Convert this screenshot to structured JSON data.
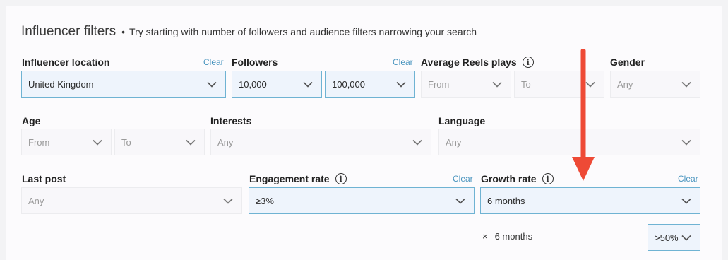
{
  "header": {
    "title": "Influencer filters",
    "bullet": "•",
    "subtitle": "Try starting with number of followers and audience filters narrowing your search"
  },
  "filters": {
    "location": {
      "label": "Influencer location",
      "clear": "Clear",
      "value": "United Kingdom"
    },
    "followers": {
      "label": "Followers",
      "clear": "Clear",
      "from": "10,000",
      "to": "100,000"
    },
    "reels": {
      "label": "Average Reels plays",
      "from": "From",
      "to": "To"
    },
    "gender": {
      "label": "Gender",
      "value": "Any"
    },
    "age": {
      "label": "Age",
      "from": "From",
      "to": "To"
    },
    "interests": {
      "label": "Interests",
      "value": "Any"
    },
    "language": {
      "label": "Language",
      "value": "Any"
    },
    "last_post": {
      "label": "Last post",
      "value": "Any"
    },
    "engagement": {
      "label": "Engagement rate",
      "clear": "Clear",
      "value": "≥3%"
    },
    "growth": {
      "label": "Growth rate",
      "clear": "Clear",
      "value": "6 months",
      "chip": "6 months",
      "chip_remove": "×",
      "threshold": ">50%"
    }
  },
  "info_glyph": "i",
  "colors": {
    "accent": "#4a95bf",
    "active_border": "#6fb3d3",
    "arrow": "#ee4a36"
  }
}
